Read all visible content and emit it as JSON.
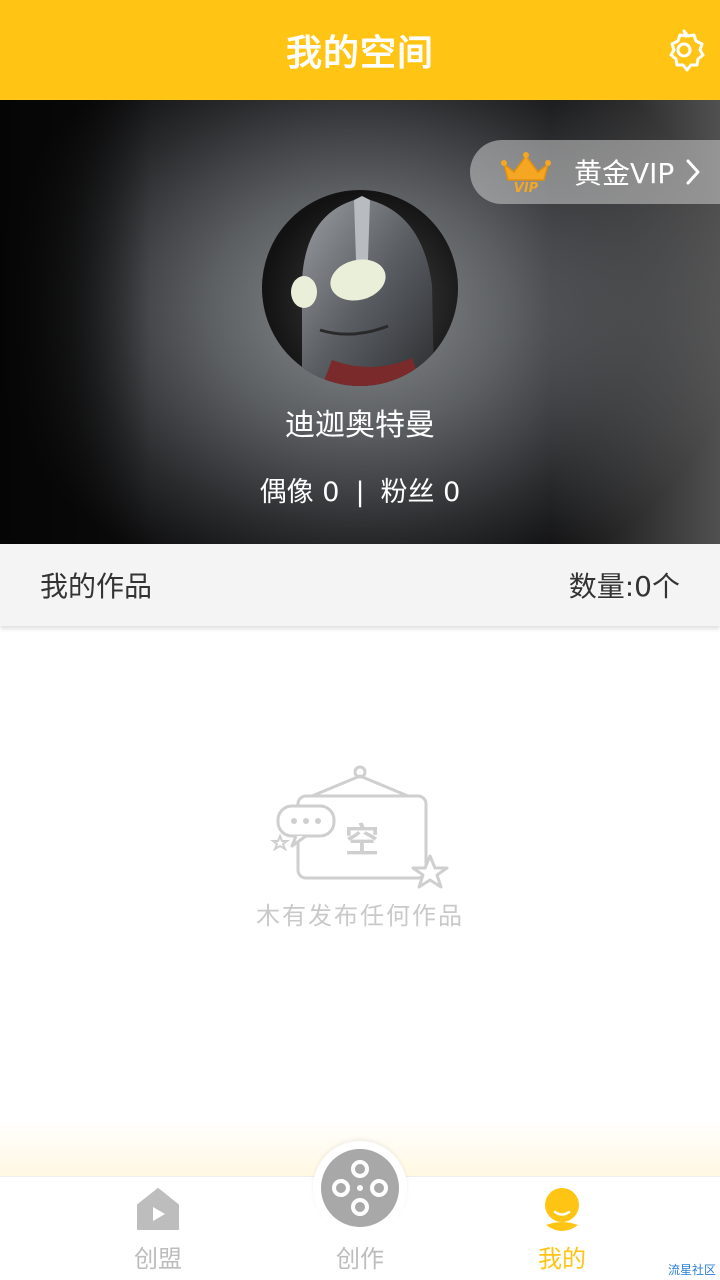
{
  "header": {
    "title": "我的空间",
    "settings_icon": "gear-icon"
  },
  "profile": {
    "vip_label": "黄金VIP",
    "vip_icon": "crown-icon",
    "username": "迪迦奥特曼",
    "idols_label": "偶像 0",
    "separator": "|",
    "fans_label": "粉丝 0"
  },
  "works": {
    "title": "我的作品",
    "count_label": "数量:0个"
  },
  "empty_state": {
    "badge_text": "空",
    "message": "木有发布任何作品"
  },
  "nav": {
    "items": [
      {
        "label": "创盟",
        "icon": "home-play-icon",
        "active": false
      },
      {
        "label": "创作",
        "icon": "film-reel-icon",
        "active": false
      },
      {
        "label": "我的",
        "icon": "user-icon",
        "active": true
      }
    ]
  },
  "watermark": "流星社区",
  "colors": {
    "accent": "#FFC414",
    "inactive": "#BDBDBD",
    "works_bar": "#F4F4F4"
  }
}
